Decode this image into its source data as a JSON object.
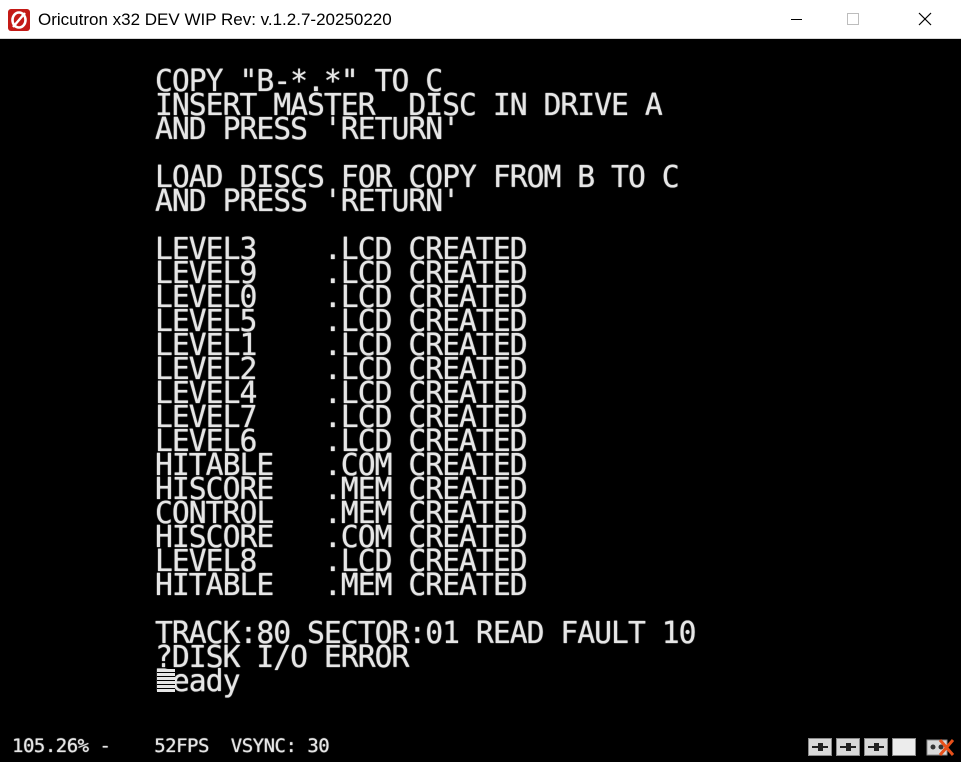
{
  "window": {
    "title": "Oricutron x32 DEV WIP Rev: v.1.2.7-20250220"
  },
  "screen": {
    "lines": [
      "",
      "COPY \"B-*.*\" TO C",
      "INSERT MASTER  DISC IN DRIVE A",
      "AND PRESS 'RETURN'",
      "",
      "LOAD DISCS FOR COPY FROM B TO C",
      "AND PRESS 'RETURN'",
      "",
      "LEVEL3    .LCD CREATED",
      "LEVEL9    .LCD CREATED",
      "LEVEL0    .LCD CREATED",
      "LEVEL5    .LCD CREATED",
      "LEVEL1    .LCD CREATED",
      "LEVEL2    .LCD CREATED",
      "LEVEL4    .LCD CREATED",
      "LEVEL7    .LCD CREATED",
      "LEVEL6    .LCD CREATED",
      "HITABLE   .COM CREATED",
      "HISCORE   .MEM CREATED",
      "CONTROL   .MEM CREATED",
      "HISCORE   .COM CREATED",
      "LEVEL8    .LCD CREATED",
      "HITABLE   .MEM CREATED",
      "",
      "TRACK:80 SECTOR:01 READ FAULT 10",
      "?DISK I/O ERROR",
      "Ready"
    ]
  },
  "status": {
    "text": "105.26% -    52FPS  VSYNC: 30"
  },
  "icons": {
    "app": "oricutron-icon",
    "minimize": "minimize-icon",
    "maximize": "maximize-icon",
    "close": "close-icon",
    "drives": "disk-drive-icon",
    "tape": "tape-icon"
  },
  "colors": {
    "screen_bg": "#000000",
    "screen_fg": "#e6e6e6",
    "icon_red": "#c41a16",
    "tape_x": "#e8501a"
  }
}
